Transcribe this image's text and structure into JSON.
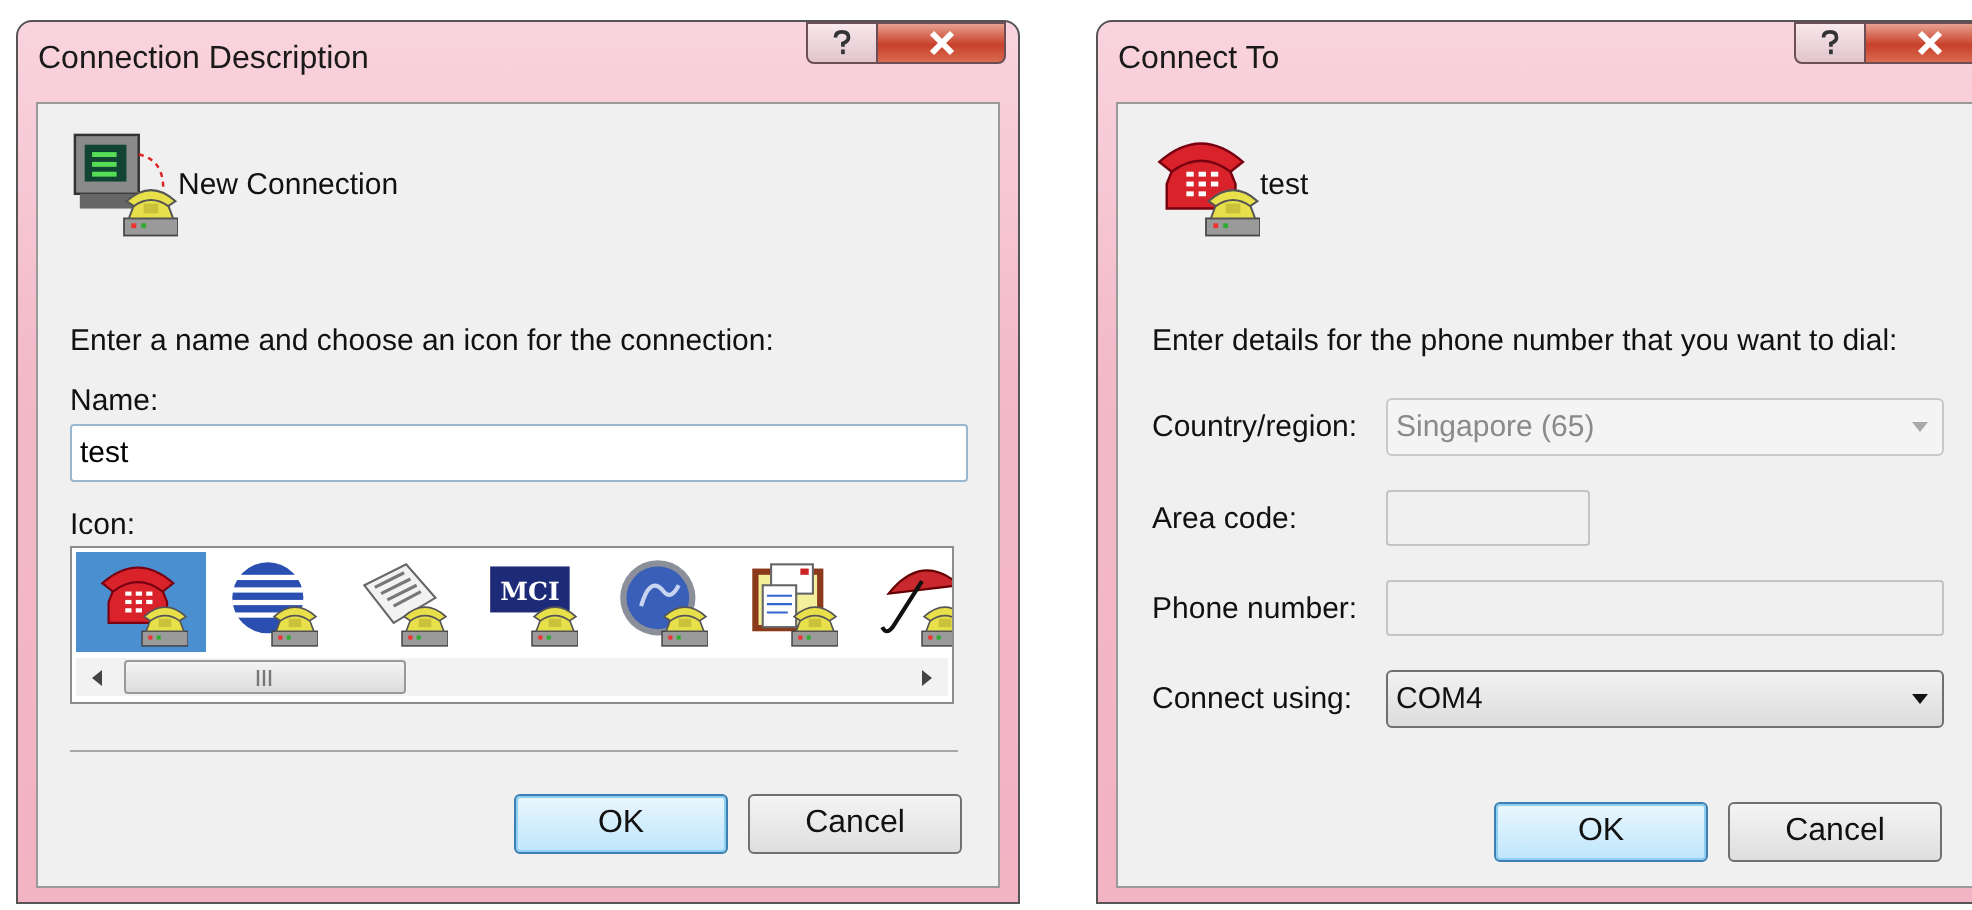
{
  "dialogs": [
    {
      "kind": "description",
      "title": "Connection Description",
      "header": {
        "kind": "terminal",
        "text": "New Connection"
      },
      "prompt": "Enter a name and choose an icon for the connection:",
      "name_field": {
        "label": "Name:",
        "value": "test"
      },
      "icon_list": {
        "label": "Icon:",
        "items": [
          {
            "kind": "phone",
            "selected": true
          },
          {
            "kind": "globe",
            "selected": false
          },
          {
            "kind": "newspaper",
            "selected": false
          },
          {
            "kind": "logo",
            "text": "MCI",
            "selected": false
          },
          {
            "kind": "ge",
            "selected": false
          },
          {
            "kind": "documents",
            "selected": false
          },
          {
            "kind": "umbrella",
            "selected": false
          }
        ]
      },
      "buttons": [
        {
          "label": "OK",
          "default": true
        },
        {
          "label": "Cancel",
          "default": false
        }
      ]
    },
    {
      "kind": "connect",
      "title": "Connect To",
      "header": {
        "kind": "phone",
        "text": "test"
      },
      "prompt": "Enter details for the phone number that you want to dial:",
      "fields": [
        {
          "kind": "dropdown",
          "label": "Country/region:",
          "value": "Singapore (65)",
          "disabled": true
        },
        {
          "kind": "short-text",
          "label": "Area code:",
          "disabled": true
        },
        {
          "kind": "text",
          "label": "Phone number:",
          "disabled": true
        },
        {
          "kind": "dropdown",
          "label": "Connect using:",
          "value": "COM4",
          "disabled": false
        }
      ],
      "buttons": [
        {
          "label": "OK",
          "default": true
        },
        {
          "label": "Cancel",
          "default": false
        }
      ]
    }
  ]
}
